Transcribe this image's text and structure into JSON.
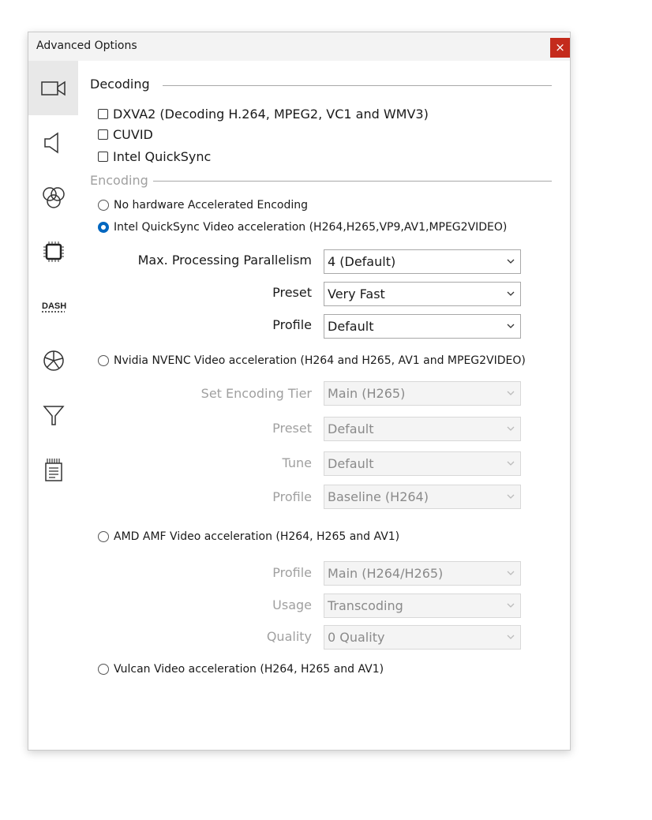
{
  "window": {
    "title": "Advanced Options",
    "close_label": "×"
  },
  "sidebar": {
    "items": [
      {
        "icon": "video-camera-icon",
        "active": true
      },
      {
        "icon": "speaker-icon",
        "active": false
      },
      {
        "icon": "color-circles-icon",
        "active": false
      },
      {
        "icon": "cpu-chip-icon",
        "active": false
      },
      {
        "icon": "dash-icon",
        "label": "DASH",
        "active": false
      },
      {
        "icon": "pie-chart-icon",
        "active": false
      },
      {
        "icon": "filter-icon",
        "active": false
      },
      {
        "icon": "document-icon",
        "active": false
      }
    ]
  },
  "decoding": {
    "header": "Decoding",
    "options": [
      {
        "label": "DXVA2 (Decoding H.264, MPEG2, VC1 and WMV3)",
        "checked": false
      },
      {
        "label": "CUVID",
        "checked": false
      },
      {
        "label": "Intel QuickSync",
        "checked": false
      }
    ]
  },
  "encoding": {
    "header": "Encoding",
    "no_hw": {
      "label": "No hardware Accelerated Encoding",
      "selected": false
    },
    "intel": {
      "label": "Intel QuickSync Video acceleration (H264,H265,VP9,AV1,MPEG2VIDEO)",
      "selected": true,
      "parallelism_label": "Max. Processing Parallelism",
      "parallelism_value": "4 (Default)",
      "preset_label": "Preset",
      "preset_value": "Very Fast",
      "profile_label": "Profile",
      "profile_value": "Default"
    },
    "nvidia": {
      "label": "Nvidia NVENC Video acceleration (H264 and H265, AV1 and MPEG2VIDEO)",
      "selected": false,
      "tier_label": "Set Encoding Tier",
      "tier_value": "Main (H265)",
      "preset_label": "Preset",
      "preset_value": "Default",
      "tune_label": "Tune",
      "tune_value": "Default",
      "profile_label": "Profile",
      "profile_value": "Baseline (H264)"
    },
    "amd": {
      "label": "AMD AMF Video acceleration (H264, H265 and AV1)",
      "selected": false,
      "profile_label": "Profile",
      "profile_value": "Main (H264/H265)",
      "usage_label": "Usage",
      "usage_value": "Transcoding",
      "quality_label": "Quality",
      "quality_value": "0 Quality"
    },
    "vulcan": {
      "label": "Vulcan Video acceleration (H264, H265 and AV1)",
      "selected": false
    }
  },
  "colors": {
    "accent": "#0067c0",
    "close": "#c42b1c",
    "disabled_text": "#a0a0a0"
  }
}
